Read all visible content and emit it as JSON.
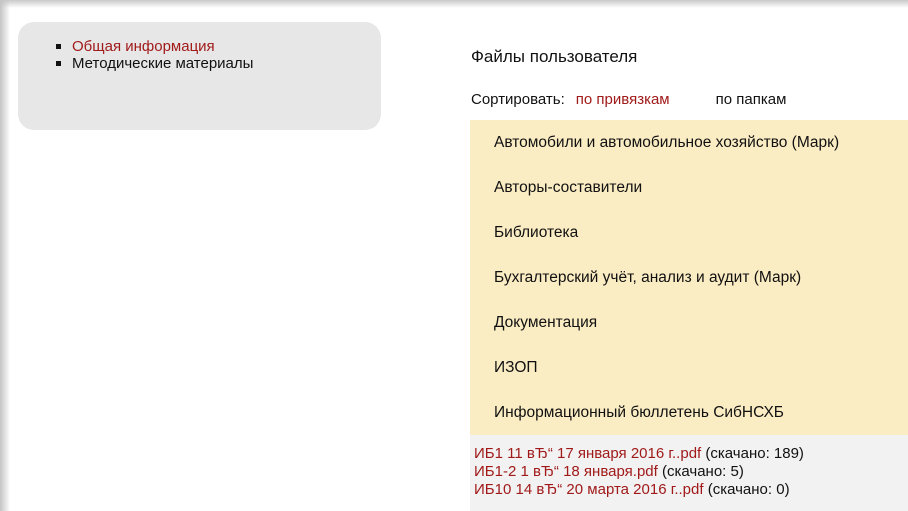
{
  "sidebar": {
    "items": [
      {
        "label": "Общая информация",
        "active": true
      },
      {
        "label": "Методические материалы",
        "active": false
      }
    ]
  },
  "main": {
    "title": "Файлы пользователя",
    "sort": {
      "label": "Сортировать:",
      "by_links": "по привязкам",
      "by_folders": "по папкам"
    },
    "folders": [
      "Автомобили и автомобильное хозяйство (Марк)",
      "Авторы-составители",
      "Библиотека",
      "Бухгалтерский учёт, анализ и аудит (Марк)",
      "Документация",
      "ИЗОП",
      "Информационный бюллетень СибНСХБ"
    ],
    "files": [
      {
        "name": "ИБ1 11 вЂ“ 17 января 2016 г..pdf",
        "count": "(скачано: 189)"
      },
      {
        "name": "ИБ1-2 1 вЂ“ 18 января.pdf",
        "count": "(скачано: 5)"
      },
      {
        "name": "ИБ10 14 вЂ“ 20 марта 2016 г..pdf",
        "count": "(скачано: 0)"
      }
    ]
  },
  "colors": {
    "link_red": "#a11a1a",
    "folder_bg": "#faecc3",
    "sidebar_bg": "#e7e7e7",
    "file_panel_bg": "#f2f2f2"
  }
}
